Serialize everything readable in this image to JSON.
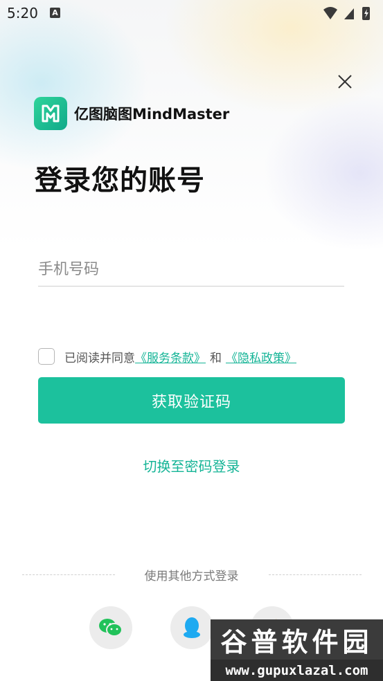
{
  "status_bar": {
    "time": "5:20",
    "notification_icon": "A"
  },
  "brand": {
    "name": "亿图脑图MindMaster",
    "logo_icon": "mindmaster-logo-icon"
  },
  "page": {
    "title": "登录您的账号"
  },
  "form": {
    "phone_placeholder": "手机号码",
    "agree_prefix": "已阅读并同意",
    "terms_link": "《服务条款》",
    "and_text": "和",
    "privacy_link": "《隐私政策》",
    "submit_label": "获取验证码"
  },
  "switch_login": "切换至密码登录",
  "other_login": {
    "label": "使用其他方式登录",
    "providers": [
      "wechat-icon",
      "qq-icon",
      "weibo-icon"
    ]
  },
  "watermark": {
    "title": "谷普软件园",
    "url": "www.gupuxlazal.com"
  },
  "colors": {
    "accent": "#1cc19d",
    "link": "#14b496"
  }
}
